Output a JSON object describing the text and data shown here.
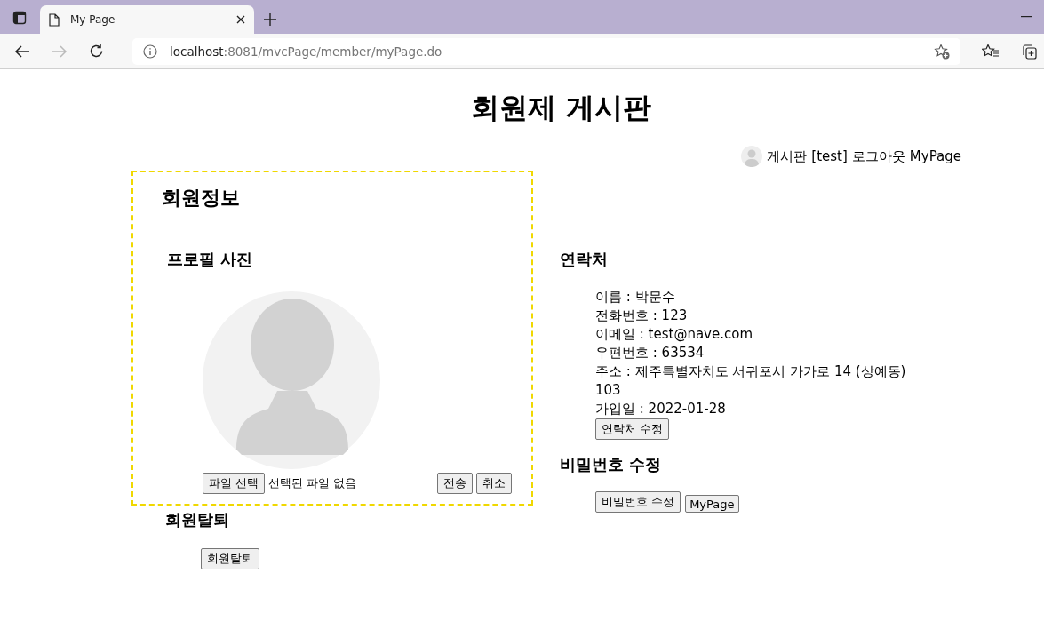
{
  "browser": {
    "tab_title": "My Page",
    "url_host": "localhost",
    "url_path": ":8081/mvcPage/member/myPage.do"
  },
  "page_title": "회원제 게시판",
  "nav_links": [
    {
      "label": "게시판"
    },
    {
      "label": "[test]"
    },
    {
      "label": "로그아웃"
    },
    {
      "label": "MyPage"
    }
  ],
  "member_info": {
    "title": "회원정보",
    "profile_heading": "프로필 사진",
    "file_button": "파일 선택",
    "file_status": "선택된 파일 없음",
    "submit_button": "전송",
    "cancel_button": "취소"
  },
  "withdraw": {
    "heading": "회원탈퇴",
    "button": "회원탈퇴"
  },
  "contact": {
    "heading": "연락처",
    "lines": [
      "이름 : 박문수",
      "전화번호 : 123",
      "이메일 : test@nave.com",
      "우편번호 : 63534",
      "주소 : 제주특별자치도 서귀포시 가가로 14 (상예동)",
      "103",
      "가입일 : 2022-01-28"
    ],
    "edit_button": "연락처 수정"
  },
  "password": {
    "heading": "비밀번호 수정",
    "buttons": [
      "비밀번호 수정",
      "MyPage"
    ]
  }
}
